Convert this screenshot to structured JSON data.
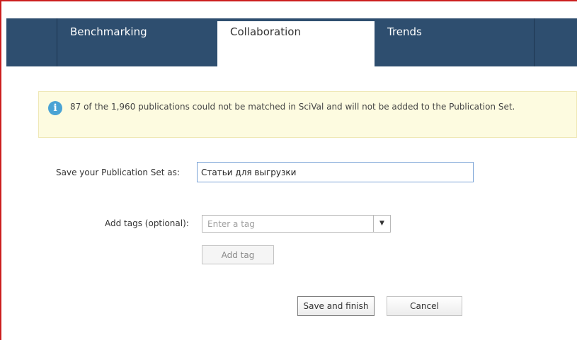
{
  "tabs": [
    {
      "label": "Benchmarking",
      "active": false
    },
    {
      "label": "Collaboration",
      "active": true
    },
    {
      "label": "Trends",
      "active": false
    }
  ],
  "notice": {
    "icon": "info-icon",
    "text": "87 of the 1,960 publications could not be matched in SciVal and will not be added to the Publication Set."
  },
  "form": {
    "save_label": "Save your Publication Set as:",
    "save_value": "Статьи для выгрузки",
    "tags_label": "Add tags (optional):",
    "tag_placeholder": "Enter a tag",
    "add_tag_label": "Add tag"
  },
  "actions": {
    "save_finish_label": "Save and finish",
    "cancel_label": "Cancel"
  },
  "colors": {
    "tabbar": "#2e4e6f",
    "notice_bg": "#fdfbe0",
    "info_icon": "#4aa3d4",
    "input_focus_border": "#7aa3d6",
    "frame": "#cc1f1f"
  }
}
